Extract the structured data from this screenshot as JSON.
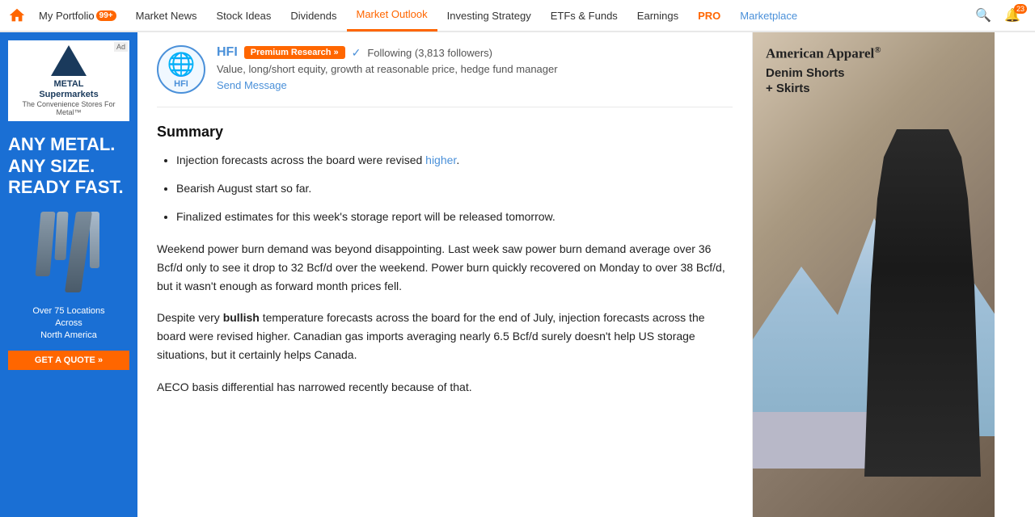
{
  "nav": {
    "logo_alt": "SA Home",
    "items": [
      {
        "id": "portfolio",
        "label": "My Portfolio",
        "badge": "99+",
        "active": false
      },
      {
        "id": "market-news",
        "label": "Market News",
        "active": false
      },
      {
        "id": "stock-ideas",
        "label": "Stock Ideas",
        "active": false
      },
      {
        "id": "dividends",
        "label": "Dividends",
        "active": false
      },
      {
        "id": "market-outlook",
        "label": "Market Outlook",
        "active": true
      },
      {
        "id": "investing-strategy",
        "label": "Investing Strategy",
        "active": false
      },
      {
        "id": "etfs-funds",
        "label": "ETFs & Funds",
        "active": false
      },
      {
        "id": "earnings",
        "label": "Earnings",
        "active": false
      },
      {
        "id": "pro",
        "label": "PRO",
        "active": false
      },
      {
        "id": "marketplace",
        "label": "Marketplace",
        "active": false
      }
    ],
    "notification_count": "23"
  },
  "left_ad": {
    "brand_line1": "METAL",
    "brand_line2": "Supermarkets",
    "tagline1": "The Convenience Stores For Metal™",
    "headline_line1": "ANY METAL.",
    "headline_line2": "ANY SIZE.",
    "headline_line3": "READY FAST.",
    "footer_line1": "Over 75 Locations",
    "footer_line2": "Across",
    "footer_line3": "North America",
    "cta": "GET A QUOTE »"
  },
  "author": {
    "ticker": "HFI",
    "avatar_abbr": "HFI",
    "badge_label": "Premium Research »",
    "following_text": "Following (3,813 followers)",
    "bio": "Value, long/short equity, growth at reasonable price, hedge fund manager",
    "send_message": "Send Message"
  },
  "article": {
    "summary_title": "Summary",
    "bullets": [
      {
        "text": "Injection forecasts across the board were revised higher.",
        "highlight": "higher"
      },
      {
        "text": "Bearish August start so far."
      },
      {
        "text": "Finalized estimates for this week's storage report will be released tomorrow."
      }
    ],
    "paragraphs": [
      "Weekend power burn demand was beyond disappointing. Last week saw power burn demand average over 36 Bcf/d only to see it drop to 32 Bcf/d over the weekend. Power burn quickly recovered on Monday to over 38 Bcf/d, but it wasn't enough as forward month prices fell.",
      "Despite very bullish temperature forecasts across the board for the end of July, injection forecasts across the board were revised higher. Canadian gas imports averaging nearly 6.5 Bcf/d surely doesn't help US storage situations, but it certainly helps Canada.",
      "AECO basis differential has narrowed recently because of that."
    ],
    "bold_words": [
      "bullish",
      "bullish temperature forecasts"
    ]
  },
  "right_ad": {
    "brand": "American Apparel",
    "reg_symbol": "®",
    "product_line1": "Denim Shorts",
    "product_line2": "+ Skirts"
  }
}
